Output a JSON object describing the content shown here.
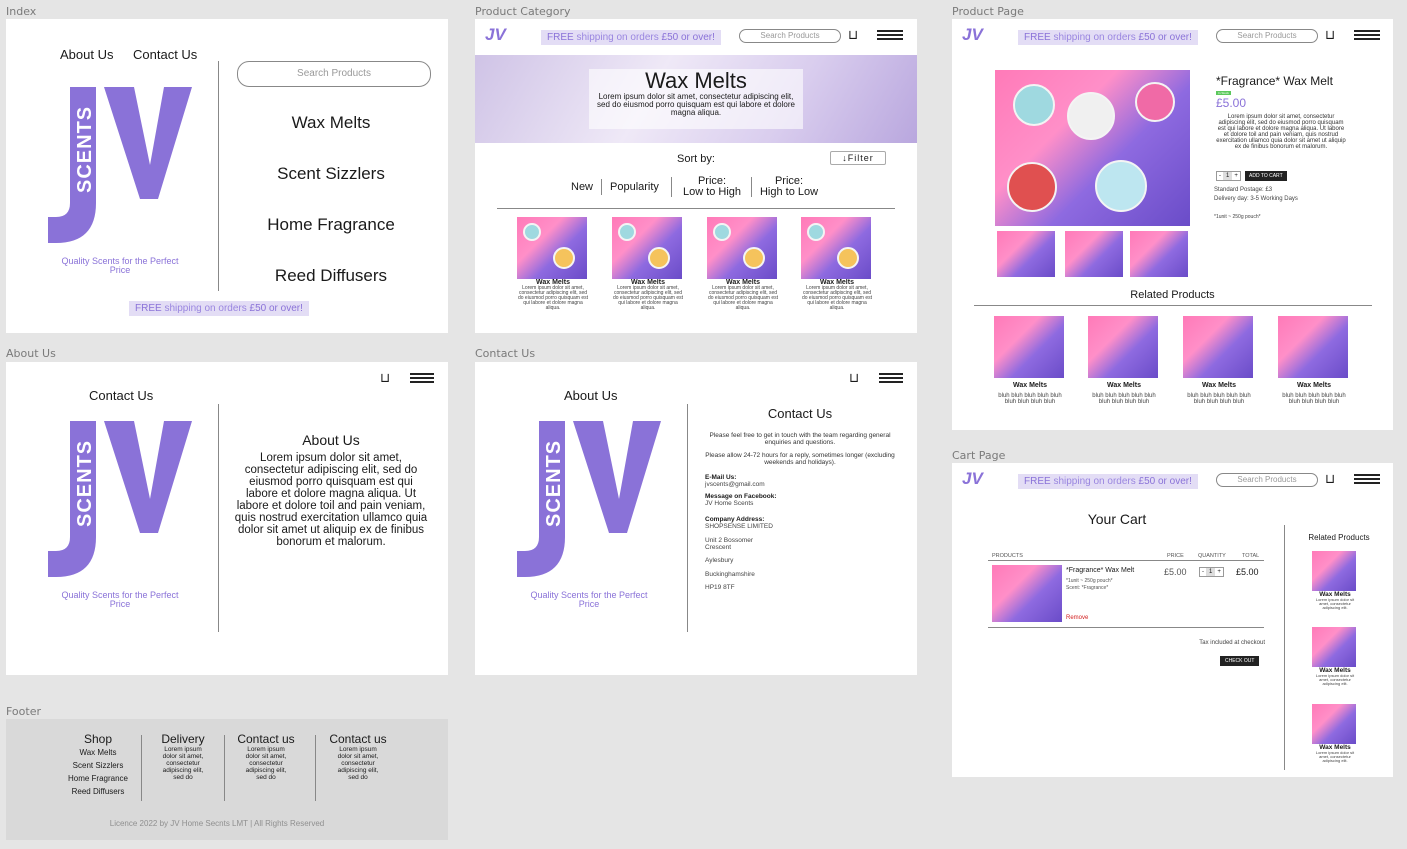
{
  "frames": {
    "index": "Index",
    "product_category": "Product Category",
    "product_page": "Product Page",
    "about_us": "About Us",
    "contact_us": "Contact Us",
    "cart_page": "Cart Page",
    "footer": "Footer"
  },
  "brand": {
    "logo_letters": "JV",
    "logo_word": "SCENTS",
    "tagline": "Quality Scents for the Perfect Price",
    "accent_color": "#8a72d8"
  },
  "shipping_strip": {
    "free": "FREE",
    "text": " shipping on orders ",
    "amount": "£50 or over!"
  },
  "search": {
    "placeholder": "Search Products"
  },
  "index": {
    "nav_about": "About Us",
    "nav_contact": "Contact Us",
    "menu": [
      "Wax Melts",
      "Scent Sizzlers",
      "Home Fragrance",
      "Reed Diffusers"
    ]
  },
  "category": {
    "title": "Wax Melts",
    "hero_text": "Lorem ipsum dolor sit amet, consectetur adipiscing elit, sed do eiusmod porro quisquam est qui labore et dolore magna aliqua.",
    "sort_label": "Sort by:",
    "filter_label": "Filter",
    "sort_options": [
      "New",
      "Popularity",
      "Price:\nLow to High",
      "Price:\nHigh to Low"
    ],
    "product_name": "Wax Melts",
    "product_desc": "Lorem ipsum dolor sit amet, consectetur adipiscing elit, sed do eiusmod porro quisquam est qui labore et dolore magna aliqua."
  },
  "product": {
    "title": "*Fragrance* Wax Melt",
    "stock_badge": "In Stock",
    "price": "£5.00",
    "description": "Lorem ipsum dolor sit amet, consectetur adipiscing elit, sed do eiusmod porro quisquam est qui labore et dolore magna aliqua. Ut labore et dolore toil and pain veniam, quis nostrud exercitation ullamco quia dolor sit amet ut aliquip ex de finibus bonorum et malorum.",
    "qty": "1",
    "qty_minus": "-",
    "qty_plus": "+",
    "add_to_cart": "ADD TO CART",
    "postage": "Standard Postage: £3",
    "delivery": "Delivery day: 3-5 Working Days",
    "note": "*1unit ~ 250g pouch*",
    "related_title": "Related Products",
    "related_name": "Wax Melts",
    "related_desc": "bluh bluh bluh bluh bluh bluh bluh bluh bluh"
  },
  "about": {
    "nav_contact": "Contact Us",
    "title": "About Us",
    "body": "Lorem ipsum dolor sit amet, consectetur adipiscing elit, sed do eiusmod porro quisquam est qui labore et dolore magna aliqua. Ut labore et dolore toil and pain veniam, quis nostrud exercitation ullamco quia dolor sit amet ut aliquip ex de finibus bonorum et malorum."
  },
  "contact": {
    "nav_about": "About Us",
    "title": "Contact Us",
    "intro1": "Please feel free to get in touch with the team regarding general enquiries and questions.",
    "intro2": "Please allow 24-72 hours for a reply, sometimes longer (excluding weekends and holidays).",
    "email_label": "E-Mail Us:",
    "email": "jvscents@gmail.com",
    "fb_label": "Message on Facebook:",
    "fb": "JV Home Scents",
    "addr_label": "Company Address:",
    "addr_lines": [
      "SHOPSENSE LIMITED",
      "Unit 2 Bossomer Crescent",
      "Aylesbury",
      "Buckinghamshire",
      "HP19 8TF"
    ]
  },
  "cart": {
    "title": "Your Cart",
    "headers": [
      "PRODUCTS",
      "PRICE",
      "QUANTITY",
      "TOTAL"
    ],
    "item_name": "*Fragrance* Wax Melt",
    "item_sub1": "*1unit ~ 250g pouch*",
    "item_sub2": "Scent: *Fragrance*",
    "item_price": "£5.00",
    "item_qty": "1",
    "item_total": "£5.00",
    "remove": "Remove",
    "tax": "Tax included at checkout",
    "checkout": "CHECK OUT",
    "related_title": "Related Products",
    "related_name": "Wax Melts",
    "related_desc": "Lorem ipsum dolor sit amet, consectetur adipiscing elit."
  },
  "footer": {
    "cols": [
      {
        "title": "Shop",
        "items": [
          "Wax Melts",
          "Scent Sizzlers",
          "Home Fragrance",
          "Reed Diffusers"
        ]
      },
      {
        "title": "Delivery",
        "text": "Lorem ipsum dolor sit amet, consectetur adipiscing elit, sed do"
      },
      {
        "title": "Contact us",
        "text": "Lorem ipsum dolor sit amet, consectetur adipiscing elit, sed do"
      },
      {
        "title": "Contact us",
        "text": "Lorem ipsum dolor sit amet, consectetur adipiscing elit, sed do"
      }
    ],
    "licence": "Licence 2022 by JV Home Secnts LMT | All Rights Reserved"
  }
}
